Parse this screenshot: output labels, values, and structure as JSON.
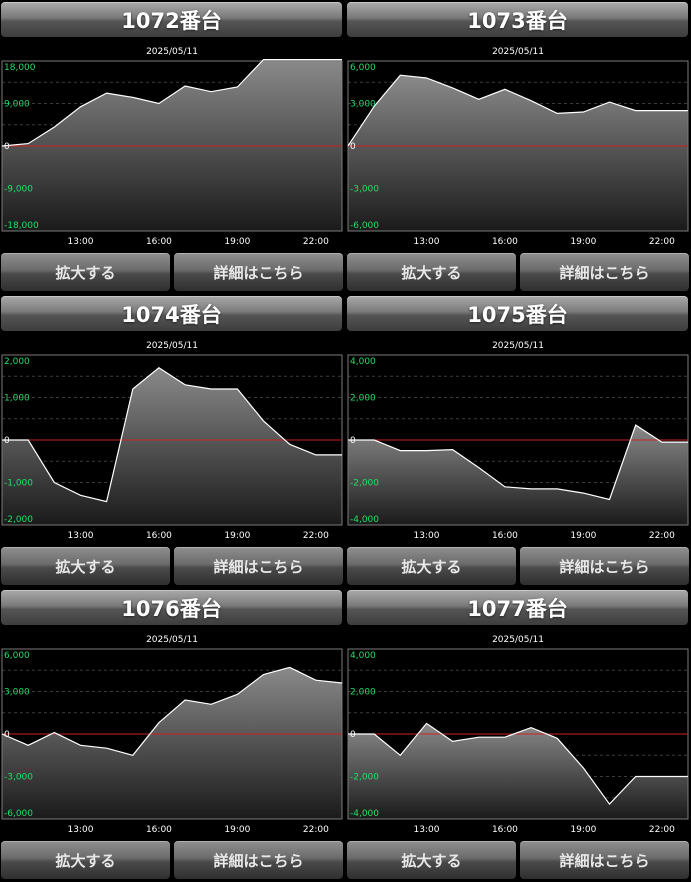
{
  "buttons": {
    "zoom": "拡大する",
    "detail": "詳細はこちら"
  },
  "chart_data": [
    {
      "type": "area",
      "title": "1072番台",
      "subtitle": "2025/05/11",
      "x_ticks": [
        "13:00",
        "16:00",
        "19:00",
        "22:00"
      ],
      "x": [
        "10:00",
        "11:00",
        "12:00",
        "13:00",
        "14:00",
        "15:00",
        "16:00",
        "17:00",
        "18:00",
        "19:00",
        "20:00",
        "21:00",
        "22:00",
        "23:00"
      ],
      "values": [
        0,
        500,
        4000,
        8300,
        11200,
        10300,
        9000,
        12700,
        11500,
        12500,
        18300,
        18300,
        18300,
        18300
      ],
      "y_ticks": [
        18000,
        9000,
        0,
        -9000,
        -18000
      ],
      "y_tick_labels": [
        "18,000",
        "9,000",
        "0",
        "-9,000",
        "-18,000"
      ],
      "ylim": [
        -18000,
        18000
      ]
    },
    {
      "type": "area",
      "title": "1073番台",
      "subtitle": "2025/05/11",
      "x_ticks": [
        "13:00",
        "16:00",
        "19:00",
        "22:00"
      ],
      "x": [
        "10:00",
        "11:00",
        "12:00",
        "13:00",
        "14:00",
        "15:00",
        "16:00",
        "17:00",
        "18:00",
        "19:00",
        "20:00",
        "21:00",
        "22:00",
        "23:00"
      ],
      "values": [
        0,
        2800,
        5000,
        4800,
        4100,
        3300,
        4000,
        3200,
        2300,
        2400,
        3100,
        2500,
        2500,
        2500
      ],
      "y_ticks": [
        6000,
        3000,
        0,
        -3000,
        -6000
      ],
      "y_tick_labels": [
        "6,000",
        "3,000",
        "0",
        "-3,000",
        "-6,000"
      ],
      "ylim": [
        -6000,
        6000
      ]
    },
    {
      "type": "area",
      "title": "1074番台",
      "subtitle": "2025/05/11",
      "x_ticks": [
        "13:00",
        "16:00",
        "19:00",
        "22:00"
      ],
      "x": [
        "10:00",
        "11:00",
        "12:00",
        "13:00",
        "14:00",
        "15:00",
        "16:00",
        "17:00",
        "18:00",
        "19:00",
        "20:00",
        "21:00",
        "22:00",
        "23:00"
      ],
      "values": [
        0,
        0,
        -1000,
        -1300,
        -1450,
        1200,
        1700,
        1300,
        1200,
        1200,
        450,
        -100,
        -350,
        -350
      ],
      "y_ticks": [
        2000,
        1000,
        0,
        -1000,
        -2000
      ],
      "y_tick_labels": [
        "2,000",
        "1,000",
        "0",
        "-1,000",
        "-2,000"
      ],
      "ylim": [
        -2000,
        2000
      ]
    },
    {
      "type": "area",
      "title": "1075番台",
      "subtitle": "2025/05/11",
      "x_ticks": [
        "13:00",
        "16:00",
        "19:00",
        "22:00"
      ],
      "x": [
        "10:00",
        "11:00",
        "12:00",
        "13:00",
        "14:00",
        "15:00",
        "16:00",
        "17:00",
        "18:00",
        "19:00",
        "20:00",
        "21:00",
        "22:00",
        "23:00"
      ],
      "values": [
        0,
        0,
        -500,
        -500,
        -450,
        -1300,
        -2200,
        -2300,
        -2300,
        -2500,
        -2800,
        700,
        -100,
        -100
      ],
      "y_ticks": [
        4000,
        2000,
        0,
        -2000,
        -4000
      ],
      "y_tick_labels": [
        "4,000",
        "2,000",
        "0",
        "-2,000",
        "-4,000"
      ],
      "ylim": [
        -4000,
        4000
      ]
    },
    {
      "type": "area",
      "title": "1076番台",
      "subtitle": "2025/05/11",
      "x_ticks": [
        "13:00",
        "16:00",
        "19:00",
        "22:00"
      ],
      "x": [
        "10:00",
        "11:00",
        "12:00",
        "13:00",
        "14:00",
        "15:00",
        "16:00",
        "17:00",
        "18:00",
        "19:00",
        "20:00",
        "21:00",
        "22:00",
        "23:00"
      ],
      "values": [
        0,
        -800,
        100,
        -800,
        -1000,
        -1500,
        800,
        2400,
        2100,
        2800,
        4200,
        4700,
        3800,
        3600
      ],
      "y_ticks": [
        6000,
        3000,
        0,
        -3000,
        -6000
      ],
      "y_tick_labels": [
        "6,000",
        "3,000",
        "0",
        "-3,000",
        "-6,000"
      ],
      "ylim": [
        -6000,
        6000
      ]
    },
    {
      "type": "area",
      "title": "1077番台",
      "subtitle": "2025/05/11",
      "x_ticks": [
        "13:00",
        "16:00",
        "19:00",
        "22:00"
      ],
      "x": [
        "10:00",
        "11:00",
        "12:00",
        "13:00",
        "14:00",
        "15:00",
        "16:00",
        "17:00",
        "18:00",
        "19:00",
        "20:00",
        "21:00",
        "22:00",
        "23:00"
      ],
      "values": [
        0,
        0,
        -1000,
        500,
        -350,
        -150,
        -150,
        300,
        -200,
        -1600,
        -3300,
        -2000,
        -2000,
        -2000
      ],
      "y_ticks": [
        4000,
        2000,
        0,
        -2000,
        -4000
      ],
      "y_tick_labels": [
        "4,000",
        "2,000",
        "0",
        "-2,000",
        "-4,000"
      ],
      "ylim": [
        -4000,
        4000
      ]
    }
  ],
  "colors": {
    "zero_line": "#cc2222",
    "line": "#ffffff",
    "tick_positive": "#22dd66",
    "tick_zero": "#ffffff",
    "grid": "#3c3c3c",
    "frame": "#7a7a7a"
  }
}
